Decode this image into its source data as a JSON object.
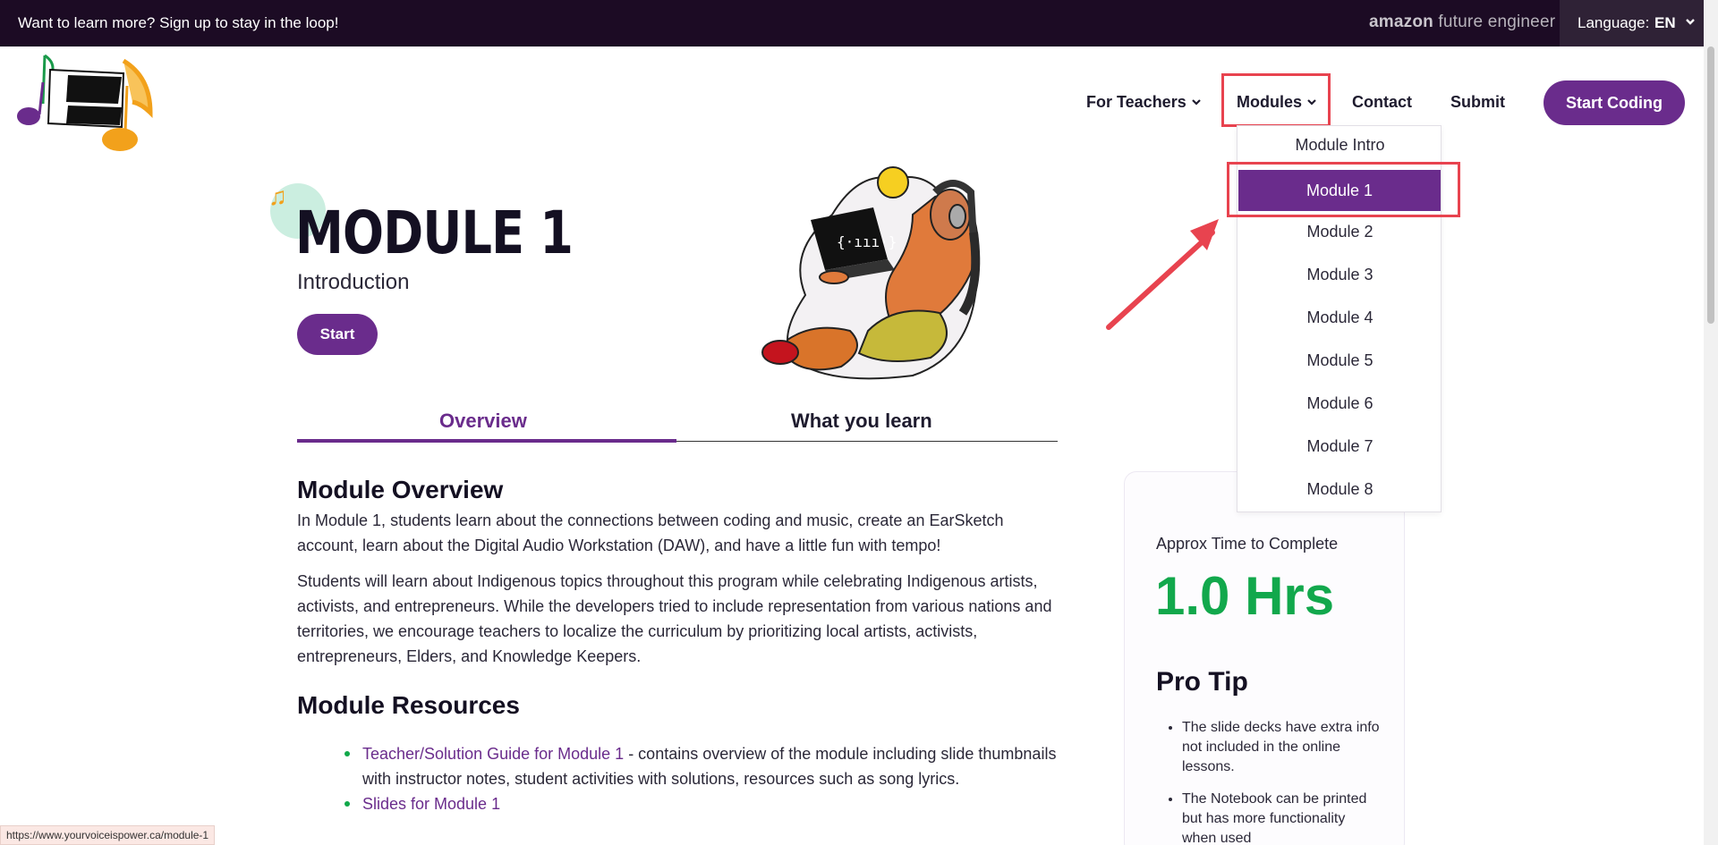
{
  "topbar": {
    "promo": "Want to learn more? Sign up to stay in the loop!",
    "partner_a": "amazon",
    "partner_b": " future engineer",
    "language_label": "Language:",
    "language_value": "EN"
  },
  "nav": {
    "teachers": "For Teachers",
    "modules": "Modules",
    "contact": "Contact",
    "submit": "Submit",
    "start_coding": "Start Coding"
  },
  "dropdown": {
    "items": [
      "Module Intro",
      "Module 1",
      "Module 2",
      "Module 3",
      "Module 4",
      "Module 5",
      "Module 6",
      "Module 7",
      "Module 8"
    ],
    "active": "Module 1"
  },
  "hero": {
    "title": "MODULE 1",
    "subtitle": "Introduction",
    "start": "Start"
  },
  "tabs": {
    "overview": "Overview",
    "learn": "What you learn"
  },
  "content": {
    "overview_heading": "Module Overview",
    "overview_p1": "In Module 1, students learn about the connections between coding and music, create an EarSketch account, learn about the Digital Audio Workstation (DAW), and have a little fun with tempo!",
    "overview_p2": "Students will learn about Indigenous topics throughout this program while celebrating Indigenous artists, activists, and entrepreneurs. While the developers tried to include representation from various nations and territories, we encourage teachers to localize the curriculum by prioritizing local artists, activists, entrepreneurs, Elders, and Knowledge Keepers.",
    "resources_heading": "Module Resources",
    "res1_link": "Teacher/Solution Guide for Module 1",
    "res1_text": " - contains overview of the module including slide thumbnails with instructor notes, student activities with solutions, resources such as song lyrics.",
    "res2_link": "Slides for Module 1"
  },
  "card": {
    "label": "Approx Time to Complete",
    "time": "1.0 Hrs",
    "tip_heading": "Pro Tip",
    "tip1": "The slide decks have extra info not included in the online lessons.",
    "tip2": "The Notebook can be printed but has more functionality when used"
  },
  "status_url": "https://www.yourvoiceispower.ca/module-1",
  "colors": {
    "brand_purple": "#6a2c8c",
    "accent_green": "#12a84c",
    "highlight_red": "#e8434f",
    "topbar_bg": "#1c0b24"
  }
}
